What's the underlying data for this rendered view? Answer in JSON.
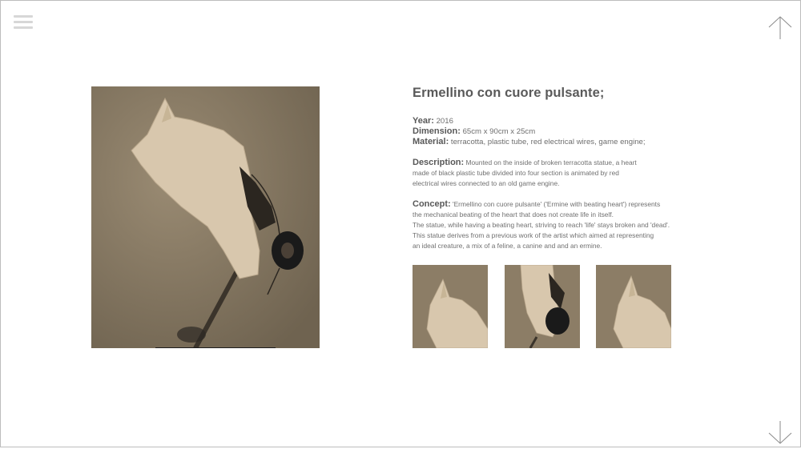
{
  "nav": {
    "menu_icon": "hamburger-icon",
    "up_icon": "arrow-up-icon",
    "down_icon": "arrow-down-icon"
  },
  "artwork": {
    "title": "Ermellino con cuore pulsante;",
    "year_label": "Year:",
    "year": "2016",
    "dimension_label": "Dimension:",
    "dimension": "65cm x 90cm x 25cm",
    "material_label": "Material:",
    "material": "terracotta, plastic tube, red electrical wires, game engine;",
    "description_label": "Description:",
    "description_lines": [
      "Mounted on  the inside of broken terracotta statue, a heart",
      "made of black plastic tube divided into four section is animated by red",
      "electrical wires connected to an old game engine."
    ],
    "concept_label": "Concept:",
    "concept_lines": [
      "'Ermellino con cuore pulsante' ('Ermine with beating heart') represents",
      "the mechanical beating of the heart that does not create life in itself.",
      "The statue, while having a beating heart, striving to reach 'life' stays broken and 'dead'.",
      "This statue derives from a previous work of the artist which aimed at representing",
      "an ideal creature, a mix of a feline, a canine and and an ermine."
    ]
  },
  "colors": {
    "background": "#ffffff",
    "photo_bg": "#8c7d66",
    "sculpture": "#d8c7ad",
    "heart": "#1a1a1a",
    "text": "#6e6e6e",
    "title": "#5a5a5a"
  }
}
